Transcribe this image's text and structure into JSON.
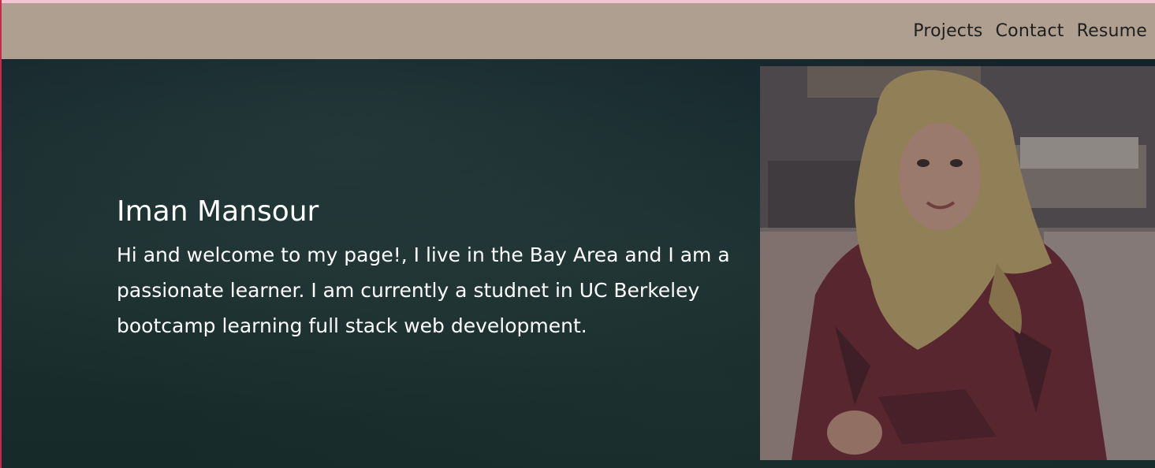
{
  "nav": {
    "links": [
      {
        "label": "Projects"
      },
      {
        "label": "Contact"
      },
      {
        "label": "Resume"
      }
    ]
  },
  "hero": {
    "name": "Iman Mansour",
    "bio": "Hi and welcome to my page!, I live in the Bay Area and I am a passionate learner. I am currently a studnet in UC Berkeley bootcamp learning full stack web development."
  },
  "colors": {
    "navbar_bg": "#ae9f90",
    "hero_bg": "#17292b",
    "accent_border": "#c8284a",
    "top_strip": "#f3c3cf"
  }
}
